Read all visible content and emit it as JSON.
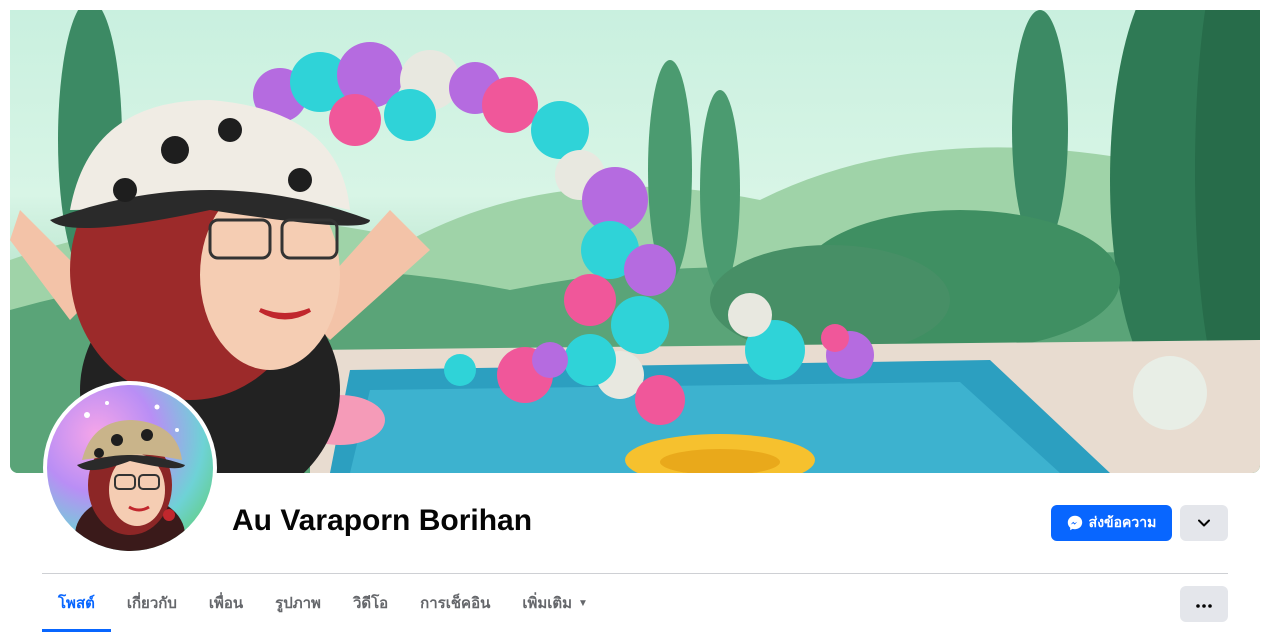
{
  "profile": {
    "name": "Au Varaporn Borihan"
  },
  "actions": {
    "message_label": "ส่งข้อความ",
    "message_icon": "messenger-icon",
    "dropdown_icon": "chevron-down-icon"
  },
  "tabs": [
    {
      "label": "โพสต์",
      "active": true
    },
    {
      "label": "เกี่ยวกับ",
      "active": false
    },
    {
      "label": "เพื่อน",
      "active": false
    },
    {
      "label": "รูปภาพ",
      "active": false
    },
    {
      "label": "วิดีโอ",
      "active": false
    },
    {
      "label": "การเช็คอิน",
      "active": false
    },
    {
      "label": "เพิ่มเติม",
      "active": false
    }
  ],
  "more_menu_icon": "more-horizontal-icon",
  "colors": {
    "accent": "#0866ff",
    "button_gray": "#e4e6eb",
    "text_primary": "#050505",
    "text_secondary": "#65676b"
  }
}
